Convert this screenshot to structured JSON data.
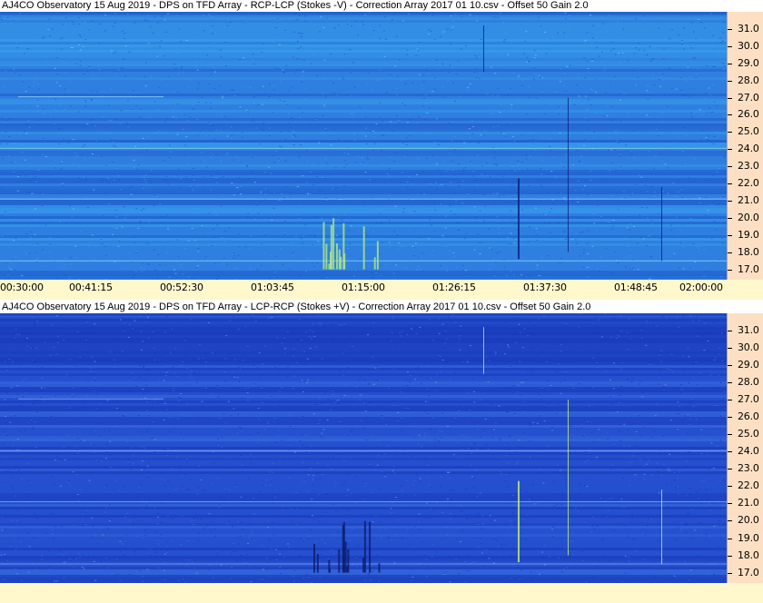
{
  "chart_data": [
    {
      "type": "heatmap",
      "title": "AJ4CO Observatory 15 Aug 2019  -  DPS on TFD Array  -  RCP-LCP (Stokes -V)  -  Correction Array 2017 01 10.csv  -  Offset 50  Gain 2.0",
      "y_ticks": [
        "31.0",
        "30.0",
        "29.0",
        "28.0",
        "27.0",
        "26.0",
        "25.0",
        "24.0",
        "23.0",
        "22.0",
        "21.0",
        "20.0",
        "19.0",
        "18.0",
        "17.0"
      ],
      "ylim": [
        16.4,
        32.0
      ],
      "palette": [
        "#1d55c8",
        "#2f7fe0",
        "#38a0ec",
        "#7dd0f5"
      ]
    },
    {
      "type": "heatmap",
      "title": "AJ4CO Observatory 15 Aug 2019  -  DPS on TFD Array  -  LCP-RCP (Stokes +V)  -  Correction Array 2017 01 10.csv  -  Offset 50  Gain 2.0",
      "y_ticks": [
        "31.0",
        "30.0",
        "29.0",
        "28.0",
        "27.0",
        "26.0",
        "25.0",
        "24.0",
        "23.0",
        "22.0",
        "21.0",
        "20.0",
        "19.0",
        "18.0",
        "17.0"
      ],
      "ylim": [
        16.4,
        32.0
      ],
      "palette": [
        "#1838b8",
        "#2550cf",
        "#3a6ee0",
        "#6fa4ef"
      ]
    }
  ],
  "time_axis": {
    "labels": [
      "00:30:00",
      "00:41:15",
      "00:52:30",
      "01:03:45",
      "01:15:00",
      "01:26:15",
      "01:37:30",
      "01:48:45",
      "02:00:00"
    ]
  }
}
